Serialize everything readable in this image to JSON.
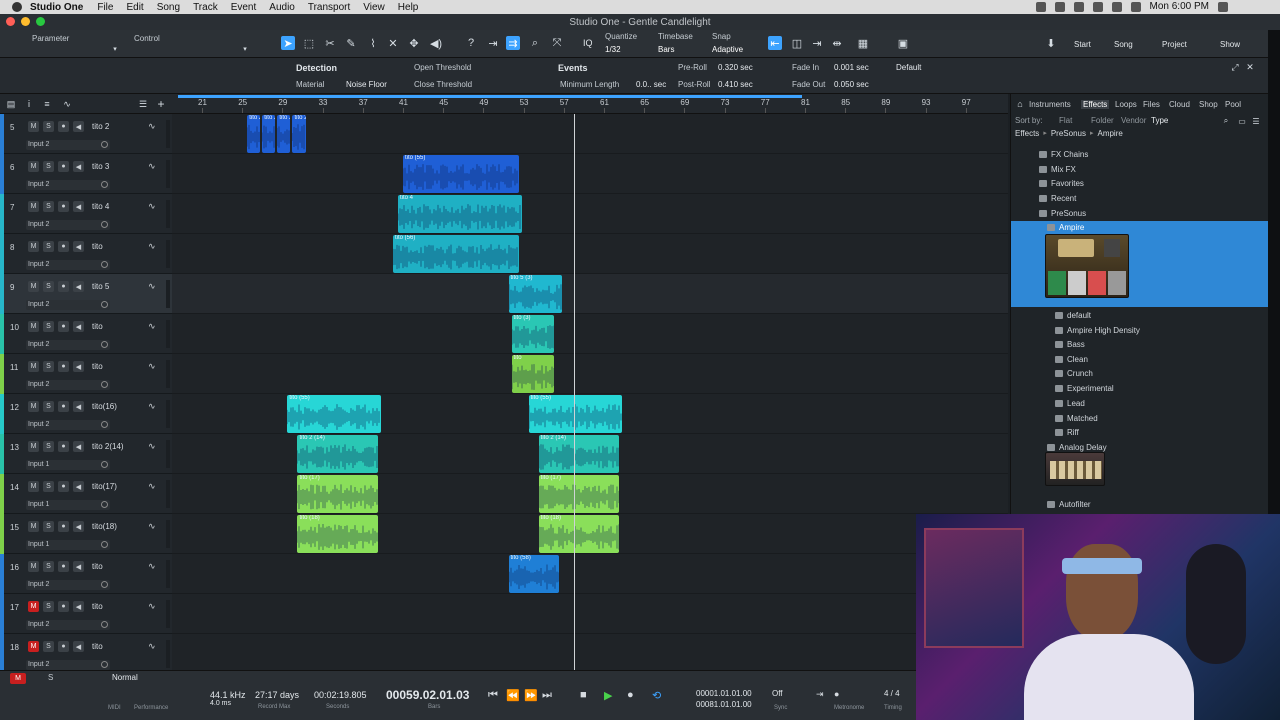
{
  "menubar": {
    "app": "Studio One",
    "items": [
      "File",
      "Edit",
      "Song",
      "Track",
      "Event",
      "Audio",
      "Transport",
      "View",
      "Help"
    ],
    "clock": "Mon 6:00 PM"
  },
  "window": {
    "title": "Studio One - Gentle Candlelight"
  },
  "toolbar": {
    "parameter_label": "Parameter",
    "control_label": "Control",
    "quantize_label": "Quantize",
    "quantize_value": "1/32",
    "timebase_label": "Timebase",
    "timebase_value": "Bars",
    "snap_label": "Snap",
    "snap_value": "Adaptive",
    "start": "Start",
    "song": "Song",
    "project": "Project",
    "show": "Show"
  },
  "inspector": {
    "detection": "Detection",
    "material": "Material",
    "noise_floor": "Noise Floor",
    "open_threshold": "Open Threshold",
    "close_threshold": "Close Threshold",
    "events": "Events",
    "minimum_length": "Minimum Length",
    "minimum_length_value": "0.0.. sec",
    "pre_roll": "Pre-Roll",
    "pre_roll_value": "0.320 sec",
    "post_roll": "Post-Roll",
    "post_roll_value": "0.410 sec",
    "fade_in": "Fade In",
    "fade_in_value": "0.001 sec",
    "fade_out": "Fade Out",
    "fade_out_value": "0.050 sec",
    "preset": "Default"
  },
  "ruler": {
    "bars": [
      "21",
      "25",
      "29",
      "33",
      "37",
      "41",
      "45",
      "49",
      "53",
      "57",
      "61",
      "65",
      "69",
      "73",
      "77",
      "81",
      "85",
      "89",
      "93",
      "97"
    ]
  },
  "tracks": [
    {
      "num": "5",
      "name": "tito 2",
      "input": "Input 2",
      "color": "#2a7fd6",
      "record": false,
      "selected": false
    },
    {
      "num": "6",
      "name": "tito 3",
      "input": "Input 2",
      "color": "#2a7fd6",
      "record": false,
      "selected": false
    },
    {
      "num": "7",
      "name": "tito 4",
      "input": "Input 2",
      "color": "#27b6c9",
      "record": false,
      "selected": false
    },
    {
      "num": "8",
      "name": "tito",
      "input": "Input 2",
      "color": "#27b6c9",
      "record": false,
      "selected": false
    },
    {
      "num": "9",
      "name": "tito 5",
      "input": "Input 2",
      "color": "#27b6c9",
      "record": false,
      "selected": true
    },
    {
      "num": "10",
      "name": "tito",
      "input": "Input 2",
      "color": "#29c2a8",
      "record": false,
      "selected": false
    },
    {
      "num": "11",
      "name": "tito",
      "input": "Input 2",
      "color": "#7fd04a",
      "record": false,
      "selected": false
    },
    {
      "num": "12",
      "name": "tito(16)",
      "input": "Input 2",
      "color": "#27c9c9",
      "record": false,
      "selected": false
    },
    {
      "num": "13",
      "name": "tito 2(14)",
      "input": "Input 1",
      "color": "#29c2a8",
      "record": false,
      "selected": false
    },
    {
      "num": "14",
      "name": "tito(17)",
      "input": "Input 1",
      "color": "#7fd04a",
      "record": false,
      "selected": false
    },
    {
      "num": "15",
      "name": "tito(18)",
      "input": "Input 1",
      "color": "#7fd04a",
      "record": false,
      "selected": false
    },
    {
      "num": "16",
      "name": "tito",
      "input": "Input 2",
      "color": "#2a7fd6",
      "record": false,
      "selected": false
    },
    {
      "num": "17",
      "name": "tito",
      "input": "Input 2",
      "color": "#2a7fd6",
      "record": true,
      "selected": false
    },
    {
      "num": "18",
      "name": "tito",
      "input": "Input 2",
      "color": "#2a7fd6",
      "record": true,
      "selected": false
    }
  ],
  "clips": [
    {
      "name": "tito 2",
      "lane": 0,
      "start": 25.5,
      "end": 26.8,
      "color": "#1f5fd6"
    },
    {
      "name": "tito 2",
      "lane": 0,
      "start": 27.0,
      "end": 28.3,
      "color": "#1f5fd6"
    },
    {
      "name": "tito 2",
      "lane": 0,
      "start": 28.5,
      "end": 29.8,
      "color": "#1f5fd6"
    },
    {
      "name": "tito 2",
      "lane": 0,
      "start": 30.0,
      "end": 31.3,
      "color": "#1f5fd6"
    },
    {
      "name": "tito (55)",
      "lane": 1,
      "start": 41,
      "end": 52.5,
      "color": "#1f5fd6"
    },
    {
      "name": "tito 4",
      "lane": 2,
      "start": 40.5,
      "end": 52.8,
      "color": "#1fb0c4"
    },
    {
      "name": "tito (56)",
      "lane": 3,
      "start": 40,
      "end": 52.5,
      "color": "#1fb0c4"
    },
    {
      "name": "tito 5 (3)",
      "lane": 4,
      "start": 51.5,
      "end": 56.8,
      "color": "#20b8d0"
    },
    {
      "name": "tito (3)",
      "lane": 5,
      "start": 51.8,
      "end": 56,
      "color": "#2ac7b4"
    },
    {
      "name": "tito",
      "lane": 6,
      "start": 51.8,
      "end": 56,
      "color": "#7fd04a"
    },
    {
      "name": "tito (55)",
      "lane": 7,
      "start": 29.5,
      "end": 38.8,
      "color": "#27d6d6"
    },
    {
      "name": "tito (55)",
      "lane": 7,
      "start": 53.5,
      "end": 62.8,
      "color": "#27d6d6"
    },
    {
      "name": "tito 2 (14)",
      "lane": 8,
      "start": 30.5,
      "end": 38.5,
      "color": "#2ac7b4"
    },
    {
      "name": "tito 2 (14)",
      "lane": 8,
      "start": 54.5,
      "end": 62.5,
      "color": "#2ac7b4"
    },
    {
      "name": "tito (17)",
      "lane": 9,
      "start": 30.5,
      "end": 38.5,
      "color": "#8adf5a"
    },
    {
      "name": "tito (17)",
      "lane": 9,
      "start": 54.5,
      "end": 62.5,
      "color": "#8adf5a"
    },
    {
      "name": "tito (18)",
      "lane": 10,
      "start": 30.5,
      "end": 38.5,
      "color": "#8adf5a"
    },
    {
      "name": "tito (18)",
      "lane": 10,
      "start": 54.5,
      "end": 62.5,
      "color": "#8adf5a"
    },
    {
      "name": "tito (58)",
      "lane": 11,
      "start": 51.5,
      "end": 56.5,
      "color": "#1f7fd6"
    }
  ],
  "playhead_bar": 58,
  "browser": {
    "tabs": [
      "Instruments",
      "Effects",
      "Loops",
      "Files",
      "Cloud",
      "Shop",
      "Pool"
    ],
    "sort_by": "Sort by:",
    "sort_options": [
      "Flat",
      "Folder",
      "Vendor",
      "Type"
    ],
    "path": [
      "Effects",
      "PreSonus",
      "Ampire"
    ],
    "items": [
      {
        "label": "FX Chains",
        "indent": 1
      },
      {
        "label": "Mix FX",
        "indent": 1
      },
      {
        "label": "Favorites",
        "indent": 1
      },
      {
        "label": "Recent",
        "indent": 1
      },
      {
        "label": "PreSonus",
        "indent": 1
      },
      {
        "label": "Ampire",
        "indent": 2,
        "selected": true
      },
      {
        "label": "default",
        "indent": 3
      },
      {
        "label": "Ampire High Density",
        "indent": 3
      },
      {
        "label": "Bass",
        "indent": 3
      },
      {
        "label": "Clean",
        "indent": 3
      },
      {
        "label": "Crunch",
        "indent": 3
      },
      {
        "label": "Experimental",
        "indent": 3
      },
      {
        "label": "Lead",
        "indent": 3
      },
      {
        "label": "Matched",
        "indent": 3
      },
      {
        "label": "Riff",
        "indent": 3
      },
      {
        "label": "Analog Delay",
        "indent": 2
      },
      {
        "label": "Autofilter",
        "indent": 2
      }
    ]
  },
  "transport": {
    "mode": "Normal",
    "midi": "MIDI",
    "performance": "Performance",
    "sample_rate": "44.1 kHz",
    "latency": "4.0 ms",
    "record_max": "27:17 days",
    "record_max_label": "Record Max",
    "seconds": "00:02:19.805",
    "seconds_label": "Seconds",
    "bars": "00059.02.01.03",
    "bars_label": "Bars",
    "loop_start": "00001.01.01.00",
    "loop_end": "00081.01.01.00",
    "sync": "Off",
    "sync_label": "Sync",
    "metronome": "Metronome",
    "time_sig": "4 / 4",
    "timing": "Timing"
  }
}
